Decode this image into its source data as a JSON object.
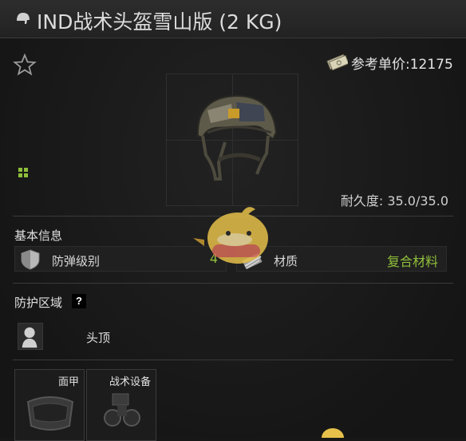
{
  "window": {
    "title": "IND战术头盔雪山版 (2 KG)",
    "title_icon": "helmet-icon"
  },
  "header": {
    "favorite_icon": "star-icon",
    "price_icon": "money-icon",
    "price_label": "参考单价:12175"
  },
  "item": {
    "image": "helmet-image",
    "durability_label": "耐久度: 35.0/35.0",
    "durability": {
      "current": 35.0,
      "max": 35.0
    }
  },
  "basic_info": {
    "title": "基本信息",
    "stats": [
      {
        "icon": "shield-icon",
        "label": "防弹级别",
        "value": "4"
      },
      {
        "icon": "material-icon",
        "label": "材质",
        "value": "复合材料"
      }
    ]
  },
  "protection": {
    "title": "防护区域",
    "help": "?",
    "zones": [
      {
        "icon": "head-silhouette-icon",
        "label": "头顶"
      }
    ]
  },
  "slots": [
    {
      "label": "面甲",
      "icon": "faceshield-icon"
    },
    {
      "label": "战术设备",
      "icon": "night-vision-icon"
    }
  ],
  "colors": {
    "accent_green": "#8fbf3a",
    "background": "#171717",
    "panel_border": "#3a3a3a"
  }
}
